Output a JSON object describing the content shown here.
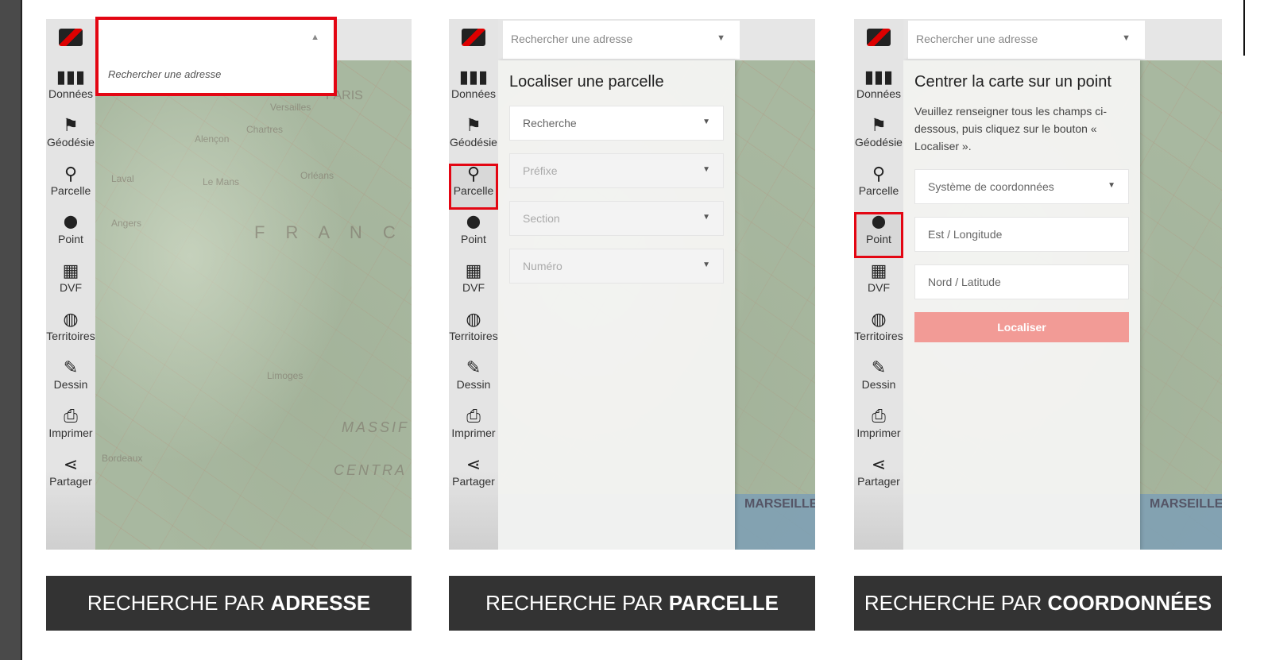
{
  "sidebar_items": [
    {
      "label": "Données",
      "icon": "map-icon",
      "glyph": "▮▮▮"
    },
    {
      "label": "Géodésie",
      "icon": "flag-icon",
      "glyph": "⚑"
    },
    {
      "label": "Parcelle",
      "icon": "search-icon",
      "glyph": "⚲"
    },
    {
      "label": "Point",
      "icon": "map-marker-icon",
      "glyph": "⬤"
    },
    {
      "label": "DVF",
      "icon": "building-icon",
      "glyph": "▦"
    },
    {
      "label": "Territoires",
      "icon": "globe-icon",
      "glyph": "◍"
    },
    {
      "label": "Dessin",
      "icon": "pencil-icon",
      "glyph": "✎"
    },
    {
      "label": "Imprimer",
      "icon": "print-icon",
      "glyph": "⎙"
    },
    {
      "label": "Partager",
      "icon": "share-icon",
      "glyph": "⋖"
    }
  ],
  "highlight_color": "#e30613",
  "search_placeholder": "Rechercher une adresse",
  "panel1": {
    "map_labels": [
      "PARIS",
      "Versailles",
      "Chartres",
      "Alençon",
      "Le Mans",
      "Orléans",
      "Laval",
      "Angers",
      "F R A N C",
      "Limoges",
      "Bordeaux",
      "MASSIF",
      "CENTRA"
    ],
    "caption_prefix": "RECHERCHE PAR ",
    "caption_bold": "ADRESSE"
  },
  "panel2": {
    "title": "Localiser une parcelle",
    "fields": [
      "Recherche",
      "Préfixe",
      "Section",
      "Numéro"
    ],
    "map_label": "MARSEILLE",
    "caption_prefix": "RECHERCHE PAR ",
    "caption_bold": "PARCELLE"
  },
  "panel3": {
    "title": "Centrer la carte sur un point",
    "description": "Veuillez renseigner tous les champs ci-dessous, puis cliquez sur le bouton « Localiser ».",
    "fields": [
      "Système de coordonnées",
      "Est / Longitude",
      "Nord / Latitude"
    ],
    "button": "Localiser",
    "button_color": "#f29b96",
    "map_label": "MARSEILLE",
    "caption_prefix": "RECHERCHE PAR ",
    "caption_bold": "COORDONNÉES"
  }
}
